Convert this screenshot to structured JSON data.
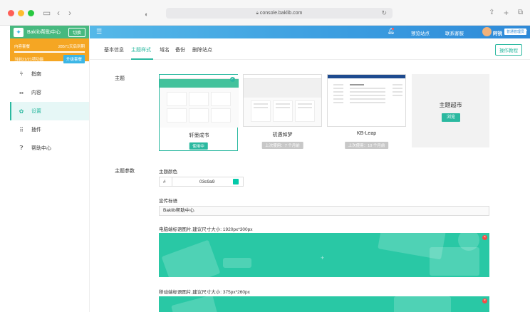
{
  "browser": {
    "url": "console.baklib.com"
  },
  "sidebar": {
    "brand_name": "Baklib帮助中心",
    "switch_label": "切换",
    "plan_name": "内容套餐",
    "plan_expiry": "28571天后到期",
    "plan_usage": "当前21/21项功能",
    "upgrade_label": "升级套餐",
    "items": [
      {
        "label": "指南",
        "icon": "sliders-icon"
      },
      {
        "label": "内容",
        "icon": "grid-icon"
      },
      {
        "label": "设置",
        "icon": "gear-icon"
      },
      {
        "label": "插件",
        "icon": "apps-icon"
      },
      {
        "label": "帮助中心",
        "icon": "help-icon"
      }
    ]
  },
  "topbar": {
    "preview_label": "预览站点",
    "contact_label": "联系客服",
    "user_name": "阿锐",
    "user_role": "普通管理员"
  },
  "tabs": {
    "items": [
      "基本信息",
      "主题样式",
      "域名",
      "备份",
      "删除站点"
    ],
    "active": "主题样式",
    "help_label": "操作教程"
  },
  "theme_section": {
    "label": "主题",
    "cards": [
      {
        "name": "轩墨成书",
        "badge": "使用中",
        "badge_color": "#2bb9a0"
      },
      {
        "name": "初遇如梦",
        "badge": "上次使用：7 个月前",
        "badge_color": "#c8c8c8"
      },
      {
        "name": "KB-Leap",
        "badge": "上次使用：10 个月前",
        "badge_color": "#c8c8c8"
      }
    ],
    "more_title": "主题超市",
    "more_button": "浏览"
  },
  "params_section": {
    "label": "主题参数",
    "color_label": "主题颜色",
    "color_hash": "#",
    "color_value": "03c9a9",
    "slogan_label": "宣传标语",
    "slogan_value": "Baklib帮助中心",
    "desktop_banner_label": "电脑端标语图片,建议尺寸大小: 1920px*300px",
    "mobile_banner_label": "移动端标语图片,建议尺寸大小: 375px*260px"
  }
}
